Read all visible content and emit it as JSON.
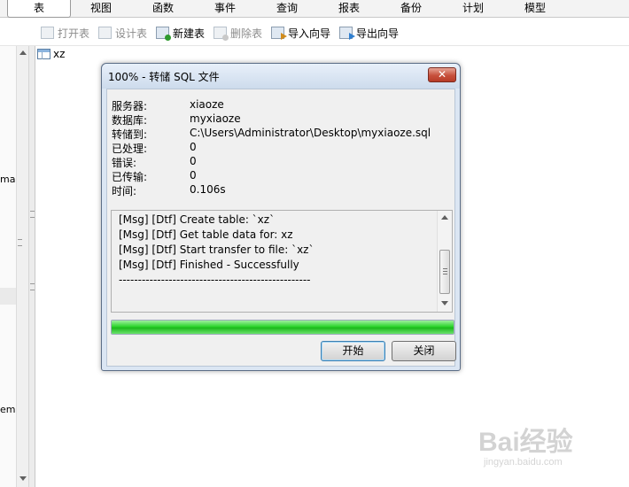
{
  "tabs": [
    "表",
    "视图",
    "函数",
    "事件",
    "查询",
    "报表",
    "备份",
    "计划",
    "模型"
  ],
  "toolbar": {
    "open_table": "打开表",
    "design_table": "设计表",
    "new_table": "新建表",
    "delete_table": "删除表",
    "import_wizard": "导入向导",
    "export_wizard": "导出向导"
  },
  "left_panel": {
    "frag1": "ma",
    "frag2": "em"
  },
  "object_list": {
    "item": "xz"
  },
  "dialog": {
    "title": "100% - 转储 SQL 文件",
    "close_glyph": "✕",
    "info": [
      {
        "label": "服务器:",
        "value": "xiaoze"
      },
      {
        "label": "数据库:",
        "value": "myxiaoze"
      },
      {
        "label": "转储到:",
        "value": "C:\\Users\\Administrator\\Desktop\\myxiaoze.sql"
      },
      {
        "label": "已处理:",
        "value": "0"
      },
      {
        "label": "错误:",
        "value": "0"
      },
      {
        "label": "已传输:",
        "value": "0"
      },
      {
        "label": "时间:",
        "value": "0.106s"
      }
    ],
    "log": [
      "[Msg] [Dtf] Create table: `xz`",
      "[Msg] [Dtf] Get table data for: xz",
      "[Msg] [Dtf] Start transfer to file: `xz`",
      "[Msg] [Dtf] Finished - Successfully",
      "--------------------------------------------------"
    ],
    "progress": 1.0,
    "buttons": {
      "start": "开始",
      "close": "关闭"
    }
  },
  "colors": {
    "progress_green": "#22c822",
    "dialog_frame": "#dbe6f3",
    "close_red": "#c7503c"
  },
  "watermark": {
    "brand": "Bai经验",
    "url": "jingyan.baidu.com"
  }
}
